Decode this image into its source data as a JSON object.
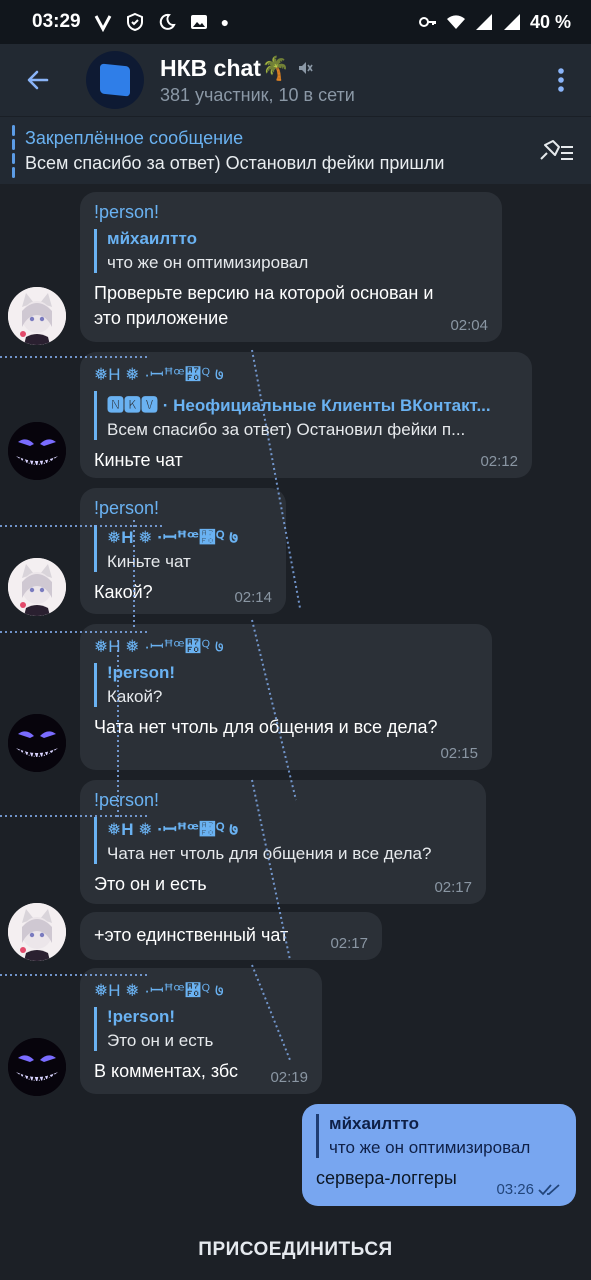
{
  "status_bar": {
    "time": "03:29",
    "battery": "40 %",
    "icons": [
      "vpn-icon",
      "shield-icon",
      "moon-icon",
      "image-icon",
      "dot-icon",
      "key-icon",
      "wifi-icon",
      "signal-icon",
      "signal-icon",
      "battery-icon"
    ]
  },
  "header": {
    "title": "НКВ chat🌴",
    "subtitle": "381 участник, 10 в сети",
    "muted": true
  },
  "pinned": {
    "title": "Закреплённое сообщение",
    "text": "Всем спасибо за ответ) Остановил фейки пришли"
  },
  "messages": [
    {
      "sender": "!person!",
      "reply_name": "мйхаилтто",
      "reply_text": "что же он оптимизировал",
      "text_line1": "Проверьте версию на которой основан и",
      "text_line2": "это приложение",
      "time": "02:04"
    },
    {
      "sender": "❅Н ❅ ·ꟷꟸꟹ꟰ꟴ ७",
      "reply_name": "🅽🅺🆅 · Неофициальные Клиенты ВКонтакт...",
      "reply_text": "Всем спасибо за ответ) Остановил фейки п...",
      "text": "Киньте чат",
      "time": "02:12"
    },
    {
      "sender": "!person!",
      "reply_name": "❅Н ❅ ·ꟷꟸꟹ꟰ꟴ ७",
      "reply_text": "Киньте чат",
      "text": "Какой?",
      "time": "02:14"
    },
    {
      "sender": "❅Н ❅ ·ꟷꟸꟹ꟰ꟴ ७",
      "reply_name": "!person!",
      "reply_text": "Какой?",
      "text": "Чата нет чтоль для общения и все дела?",
      "time": "02:15"
    },
    {
      "sender": "!person!",
      "reply_name": "❅Н ❅ ·ꟷꟸꟹ꟰ꟴ ७",
      "reply_text": "Чата нет чтоль для общения и все дела?",
      "text": "Это он и есть",
      "time": "02:17"
    },
    {
      "text": "+это единственный чат",
      "time": "02:17"
    },
    {
      "sender": "❅Н ❅ ·ꟷꟸꟹ꟰ꟴ ७",
      "reply_name": "!person!",
      "reply_text": "Это он и есть",
      "text": "В комментах, збс",
      "time": "02:19"
    },
    {
      "reply_name": "мйхаилтто",
      "reply_text": "что же он оптимизировал",
      "text": "сервера-логгеры",
      "time": "03:26",
      "read": true
    }
  ],
  "join_button": "ПРИСОЕДИНИТЬСЯ",
  "colors": {
    "background": "#1c2026",
    "bar": "#222932",
    "bubble_in": "#2b3037",
    "bubble_out": "#78a6f0",
    "accent": "#6ab2f2"
  }
}
